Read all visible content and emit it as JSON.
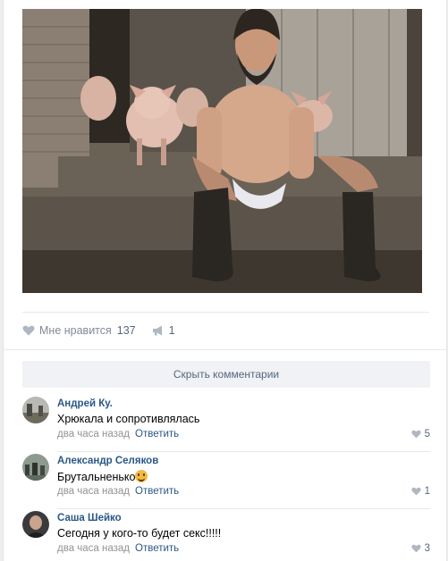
{
  "post": {
    "photo_icon": "post-photo",
    "likes": {
      "label": "Мне нравится",
      "count": "137"
    },
    "shares": {
      "count": "1"
    }
  },
  "comments_section": {
    "hide_label": "Скрыть комментарии",
    "comments": [
      {
        "author": "Андрей Ку.",
        "text": "Хрюкала и сопротивлялась",
        "time": "два часа назад",
        "reply": "Ответить",
        "likes": "5"
      },
      {
        "author": "Александр Селяков",
        "text": "Брутальненько",
        "time": "два часа назад",
        "reply": "Ответить",
        "likes": "1"
      },
      {
        "author": "Саша Шейко",
        "text": "Сегодня у кого-то будет секс!!!!!",
        "time": "два часа назад",
        "reply": "Ответить",
        "likes": "3"
      }
    ]
  },
  "colors": {
    "link": "#2a5885",
    "muted": "#939393",
    "button_bg": "#f0f2f5"
  }
}
